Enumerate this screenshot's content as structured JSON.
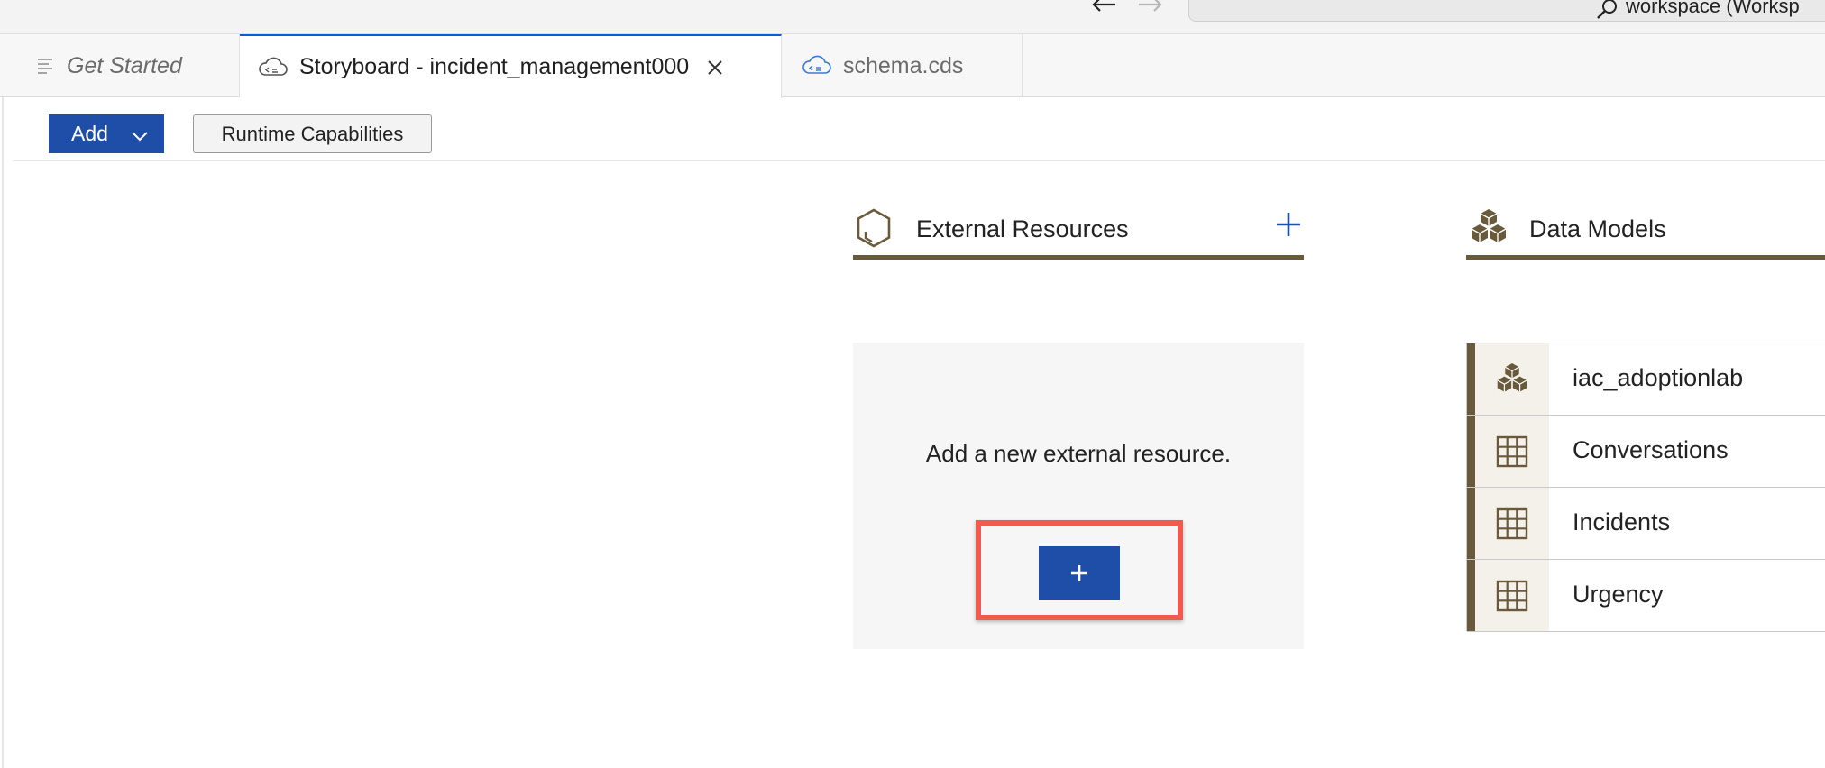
{
  "titlebar": {
    "search_text": "workspace (Worksp"
  },
  "tabs": [
    {
      "label": "Get Started"
    },
    {
      "label": "Storyboard - incident_management000"
    },
    {
      "label": "schema.cds"
    }
  ],
  "toolbar": {
    "add_label": "Add",
    "runtime_label": "Runtime Capabilities"
  },
  "external_resources": {
    "title": "External Resources",
    "message": "Add a new external resource.",
    "add_button_label": "+"
  },
  "data_models": {
    "title": "Data Models",
    "items": [
      {
        "label": "iac_adoptionlab",
        "icon": "cube-icon"
      },
      {
        "label": "Conversations",
        "icon": "table-icon"
      },
      {
        "label": "Incidents",
        "icon": "table-icon"
      },
      {
        "label": "Urgency",
        "icon": "table-icon"
      }
    ]
  },
  "colors": {
    "accent_blue": "#1f4ea8",
    "header_rule": "#6a5a3c",
    "highlight_red": "#f05a4f"
  }
}
